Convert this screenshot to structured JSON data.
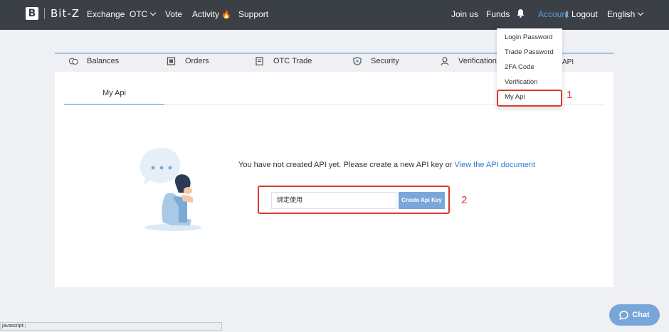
{
  "brand": {
    "logo_letter": "B",
    "name": "Bit-Z"
  },
  "nav": {
    "exchange": "Exchange",
    "otc": "OTC",
    "vote": "Vote",
    "activity": "Activity",
    "support": "Support",
    "join_us": "Join us",
    "funds": "Funds",
    "account": "Account",
    "divider": "|",
    "logout": "Logout",
    "language": "English"
  },
  "tabs": {
    "balances": "Balances",
    "orders": "Orders",
    "otc_trade": "OTC Trade",
    "security": "Security",
    "verification": "Verification",
    "api_partial": "API"
  },
  "account_menu": {
    "login_password": "Login Password",
    "trade_password": "Trade Password",
    "twofa": "2FA Code",
    "verification": "Verification",
    "my_api": "My Api"
  },
  "content": {
    "subtab": "My Api",
    "empty_text": "You have not created API yet. Please create a new API key or ",
    "doc_link": "View the API document",
    "input_value": "绑定使用",
    "create_button": "Create Api Key"
  },
  "annotations": {
    "one": "1",
    "two": "2"
  },
  "chat": {
    "label": "Chat"
  },
  "status_bar": {
    "text": "javascript:;"
  },
  "colors": {
    "topbar": "#3b3f46",
    "accent": "#5aa0e6",
    "button": "#7aa7d9",
    "highlight": "#d83a33"
  }
}
